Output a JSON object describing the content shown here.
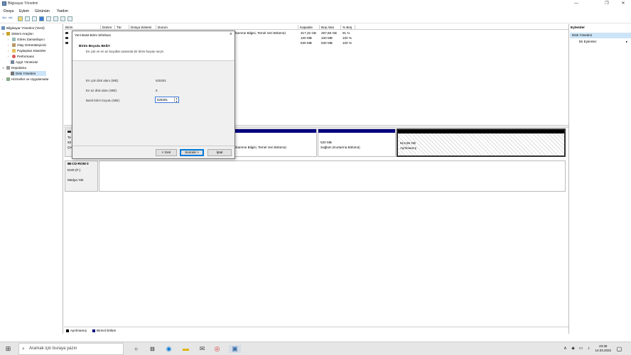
{
  "window": {
    "title": "Bilgisayar Yönetimi",
    "minimize_glyph": "—",
    "maximize_glyph": "❐",
    "close_glyph": "✕"
  },
  "menu": [
    "Dosya",
    "Eylem",
    "Görünüm",
    "Yardım"
  ],
  "tree": {
    "root": "Bilgisayar Yönetimi (Yerel)",
    "system_tools": "Sistem Araçları",
    "task_scheduler": "Görev Zamanlayıcı",
    "event_viewer": "Olay Görüntüleyicisi",
    "shared_folders": "Paylaşılan Klasörler",
    "performance": "Performans",
    "device_manager": "Aygıt Yöneticisi",
    "storage": "Depolama",
    "disk_management": "Disk Yönetimi",
    "services": "Hizmetler ve Uygulamalar"
  },
  "grid": {
    "headers": [
      "Birim",
      "Düzen",
      "Tür",
      "Dosya Sistemi",
      "Durum",
      "Kapasite",
      "Boş Alan",
      "% Boş"
    ],
    "rows": [
      {
        "status_tail": "ıltamme Bilgisi, Temel Veri Bölümü)",
        "capacity": "317,32 GB",
        "free": "287,68 GB",
        "pct": "91 %"
      },
      {
        "status_tail": "",
        "capacity": "100 MB",
        "free": "100 MB",
        "pct": "100 %"
      },
      {
        "status_tail": "",
        "capacity": "530 MB",
        "free": "530 MB",
        "pct": "100 %"
      }
    ]
  },
  "disks": {
    "disk0": {
      "label_short": "Te",
      "label_line2": "93",
      "label_line3": "Çe",
      "part_main_status": "ıltamme Bilgisi, Temel Veri Bölümü)",
      "part_recovery_size": "530 MB",
      "part_recovery_status": "Sağlam (Kurtarma Bölümü)",
      "part_unalloc_size": "613,56 GB",
      "part_unalloc_status": "Ayrılmamış"
    },
    "cdrom": {
      "title": "CD-ROM 0",
      "sub": "DVD (F:)",
      "media": "Medya Yok"
    }
  },
  "legend": {
    "unallocated": "Ayrılmamış",
    "primary": "Birincil bölüm",
    "unallocated_color": "#000000",
    "primary_color": "#000080"
  },
  "actions": {
    "header": "Eylemler",
    "selected": "Disk Yönetimi",
    "more": "Ek Eylemler"
  },
  "dialog": {
    "title": "Yeni Basit Birim Sihirbazı",
    "heading": "Birim Boyutu Belirt",
    "subheading": "En çok ve en az boyutlar arasında bir birim boyutu seçin",
    "max_label": "En çok disk alanı (MB):",
    "max_value": "628281",
    "min_label": "En az disk alanı (MB):",
    "min_value": "8",
    "size_label": "Basit birim boyutu (MB):",
    "size_value": "628281",
    "back": "< Geri",
    "next": "Sonraki >",
    "cancel": "İptal"
  },
  "taskbar": {
    "search_placeholder": "Aramak için buraya yazın",
    "time": "23:39",
    "date": "14.03.2022"
  }
}
